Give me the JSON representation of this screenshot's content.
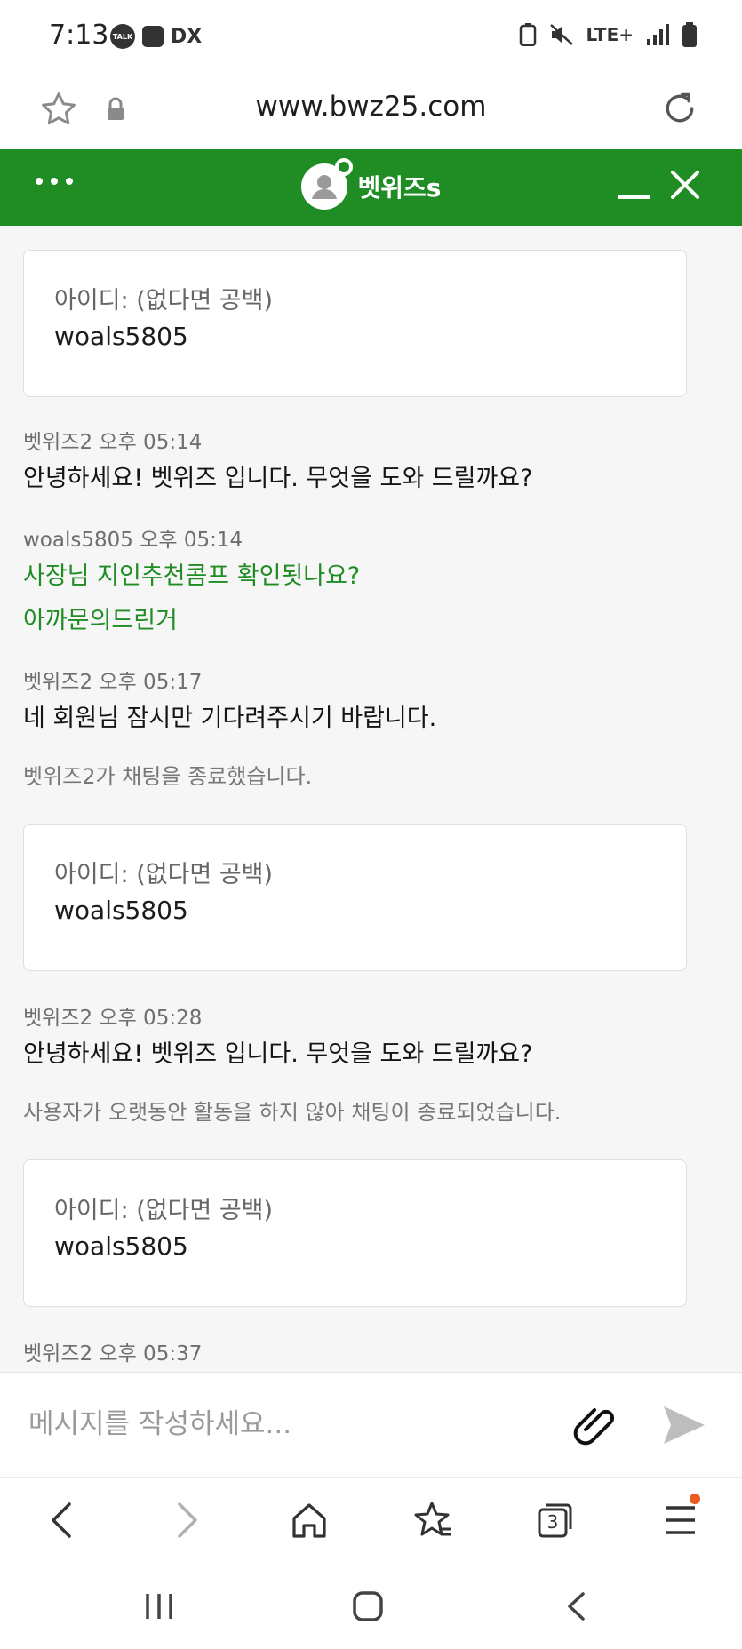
{
  "status_bar": {
    "time": "7:13",
    "talk_label": "TALK",
    "dx_label": "DX",
    "network_label": "LTE+"
  },
  "url_bar": {
    "url": "www.bwz25.com"
  },
  "chat_header": {
    "title": "벳위즈s"
  },
  "chat": {
    "form_cards": [
      {
        "label": "아이디: (없다면 공백)",
        "value": "woals5805"
      },
      {
        "label": "아이디: (없다면 공백)",
        "value": "woals5805"
      },
      {
        "label": "아이디: (없다면 공백)",
        "value": "woals5805"
      }
    ],
    "messages": [
      {
        "meta": "벳위즈2 오후 05:14",
        "text": "안녕하세요! 벳위즈 입니다. 무엇을 도와 드릴까요?"
      },
      {
        "meta": "woals5805 오후 05:14",
        "text": "사장님 지인추천콤프 확인됫나요?",
        "text2": "아까문의드린거"
      },
      {
        "meta": "벳위즈2 오후 05:17",
        "text": "네 회원님 잠시만 기다려주시기 바랍니다."
      },
      {
        "meta": "벳위즈2 오후 05:28",
        "text": "안녕하세요! 벳위즈 입니다. 무엇을 도와 드릴까요?"
      },
      {
        "meta": "벳위즈2 오후 05:37"
      }
    ],
    "system_notices": [
      "벳위즈2가 채팅을 종료했습니다.",
      "사용자가 오랫동안 활동을 하지 않아 채팅이 종료되었습니다."
    ]
  },
  "input": {
    "placeholder": "메시지를 작성하세요..."
  },
  "browser_nav": {
    "tab_count": "3"
  },
  "colors": {
    "accent": "#1f8c24",
    "menu_badge": "#ec5a1e"
  }
}
